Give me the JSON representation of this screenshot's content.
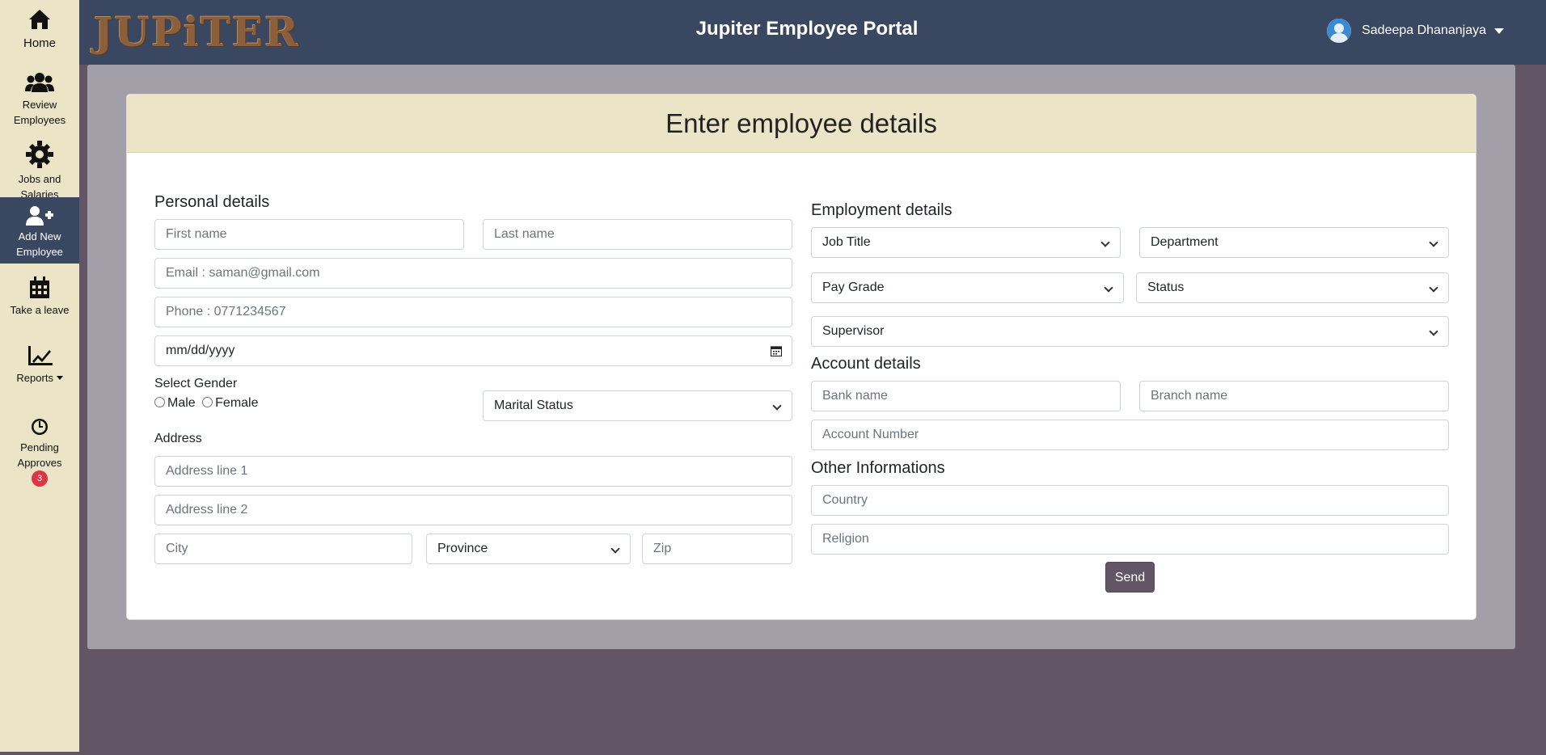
{
  "sidebar": {
    "home": "Home",
    "review_1": "Review",
    "review_2": "Employees",
    "jobs_1": "Jobs and",
    "jobs_2": "Salaries",
    "add_1": "Add New",
    "add_2": "Employee",
    "leave": "Take a leave",
    "reports": "Reports",
    "pending_1": "Pending",
    "pending_2": "Approves",
    "pending_count": "3"
  },
  "header": {
    "logo": "JUPiTER",
    "title": "Jupiter Employee Portal",
    "user": "Sadeepa Dhananjaya"
  },
  "form": {
    "title": "Enter employee details",
    "personal": {
      "heading": "Personal details",
      "first_name": "First name",
      "last_name": "Last name",
      "email": "Email : saman@gmail.com",
      "phone": "Phone : 0771234567",
      "dob": "mm/dd/yyyy",
      "gender_label": "Select Gender",
      "male": "Male",
      "female": "Female",
      "marital": "Marital Status",
      "address_label": "Address",
      "address1": "Address line 1",
      "address2": "Address line 2",
      "city": "City",
      "province": "Province",
      "zip": "Zip"
    },
    "employment": {
      "heading": "Employment details",
      "job_title": "Job Title",
      "department": "Department",
      "pay_grade": "Pay Grade",
      "status": "Status",
      "supervisor": "Supervisor"
    },
    "account": {
      "heading": "Account details",
      "bank": "Bank name",
      "branch": "Branch name",
      "account_number": "Account Number"
    },
    "other": {
      "heading": "Other Informations",
      "country": "Country",
      "religion": "Religion"
    },
    "send": "Send"
  }
}
